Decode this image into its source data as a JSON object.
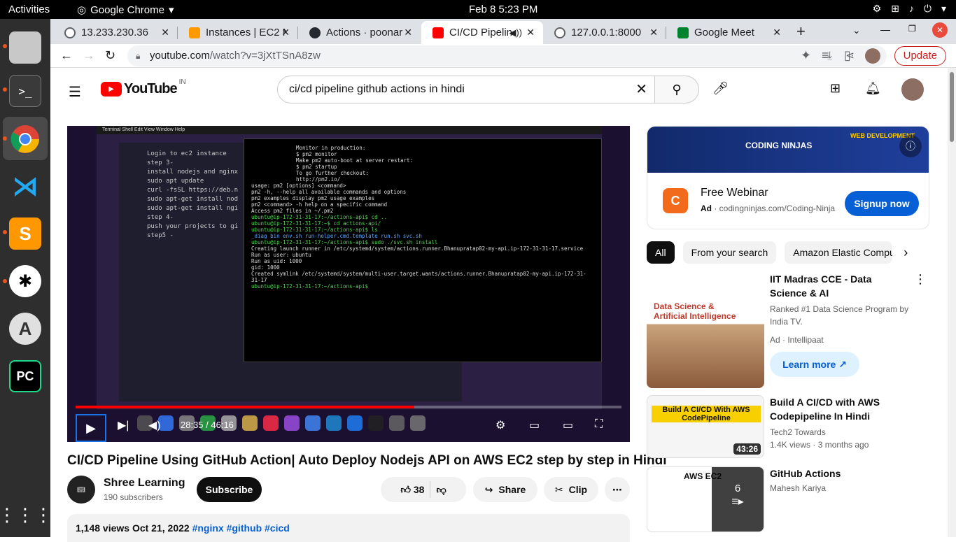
{
  "os": {
    "activities": "Activities",
    "app_name": "Google Chrome",
    "clock": "Feb 8  5:23 PM"
  },
  "browser": {
    "tabs": [
      {
        "title": "13.233.230.36",
        "color": "#5f6368"
      },
      {
        "title": "Instances | EC2 N",
        "color": "#ff9900"
      },
      {
        "title": "Actions · poonar",
        "color": "#24292f"
      },
      {
        "title": "CI/CD Pipelin",
        "color": "#ff0000"
      },
      {
        "title": "127.0.0.1:8000",
        "color": "#5f6368"
      },
      {
        "title": "Google Meet",
        "color": "#00832d"
      }
    ],
    "url_host": "youtube.com",
    "url_path": "/watch?v=3jXtTSnA8zw",
    "update_label": "Update"
  },
  "youtube": {
    "logo_text": "YouTube",
    "region": "IN",
    "search_value": "ci/cd pipeline github actions in hindi",
    "player": {
      "time": "28:35 / 46:16",
      "progress": 0.62,
      "term_lines": [
        "Monitor in production:",
        "$ pm2 monitor",
        "",
        "Make pm2 auto-boot at server restart:",
        "$ pm2 startup",
        "",
        "To go further checkout:",
        "http://pm2.io/",
        "",
        "usage: pm2 [options] <command>",
        "pm2 -h, --help        all available commands and options",
        "pm2 examples          display pm2 usage examples",
        "pm2 <command> -h      help on a specific command",
        "Access pm2 files in ~/.pm2",
        "ubuntu@ip-172-31-31-17:~/actions-api$ cd ..",
        "ubuntu@ip-172-31-31-17:~$ cd actions-api/",
        "ubuntu@ip-172-31-31-17:~/actions-api$ ls",
        "_diag   bin   env.sh   run-helper.cmd.template   run.sh   svc.sh",
        "ubuntu@ip-172-31-31-17:~/actions-api$ sudo ./svc.sh install",
        "Creating launch runner in /etc/systemd/system/actions.runner.Bhanupratap02-my-api.ip-172-31-31-17.service",
        "Run as user: ubuntu",
        "Run as uid: 1000",
        "gid: 1000",
        "Created symlink /etc/systemd/system/multi-user.target.wants/actions.runner.Bhanupratap02-my-api.ip-172-31-31-17",
        "ubuntu@ip-172-31-31-17:~/actions-api$"
      ],
      "editor_lines": [
        "Login to ec2 instance",
        "",
        "step 3-",
        "install nodejs and nginx",
        "sudo apt update",
        "curl -fsSL https://deb.n",
        "",
        "sudo apt-get install nod",
        "",
        "sudo apt-get install ngi",
        "",
        "step 4-",
        "push your projects to gi",
        "",
        "step5 -"
      ]
    },
    "video_title": "CI/CD Pipeline Using GitHub Action| Auto Deploy Nodejs API on AWS EC2 step by step in Hindi",
    "channel_name": "Shree Learning",
    "channel_subs": "190 subscribers",
    "subscribe": "Subscribe",
    "likes": "38",
    "share": "Share",
    "clip": "Clip",
    "views": "1,148 views",
    "date": "Oct 21, 2022",
    "tags": "#nginx #github #cicd",
    "ad": {
      "title": "Free Webinar",
      "label": "Ad",
      "domain": "codingninjas.com/Coding-Ninja",
      "cta": "Signup now",
      "banner_brand": "CODING NINJAS",
      "banner_text": "WEB DEVELOPMENT"
    },
    "chips": [
      "All",
      "From your search",
      "Amazon Elastic Compu"
    ],
    "recs": [
      {
        "title": "IIT Madras CCE - Data Science & AI",
        "meta1": "Ranked #1 Data Science Program by India TV.",
        "meta2": "Ad · Intellipaat",
        "cta": "Learn more",
        "thumb_text": "Data Science & Artificial Intelligence"
      },
      {
        "title": "Build A CI/CD with AWS Codepipeline In Hindi",
        "meta1": "Tech2 Towards",
        "meta2": "1.4K views · 3 months ago",
        "duration": "43:26",
        "thumb_text": "Build A CI/CD With AWS CodePipeline"
      },
      {
        "title": "GitHub Actions",
        "meta1": "Mahesh Kariya",
        "playlist_count": "6",
        "thumb_text": "AWS EC2"
      }
    ]
  }
}
